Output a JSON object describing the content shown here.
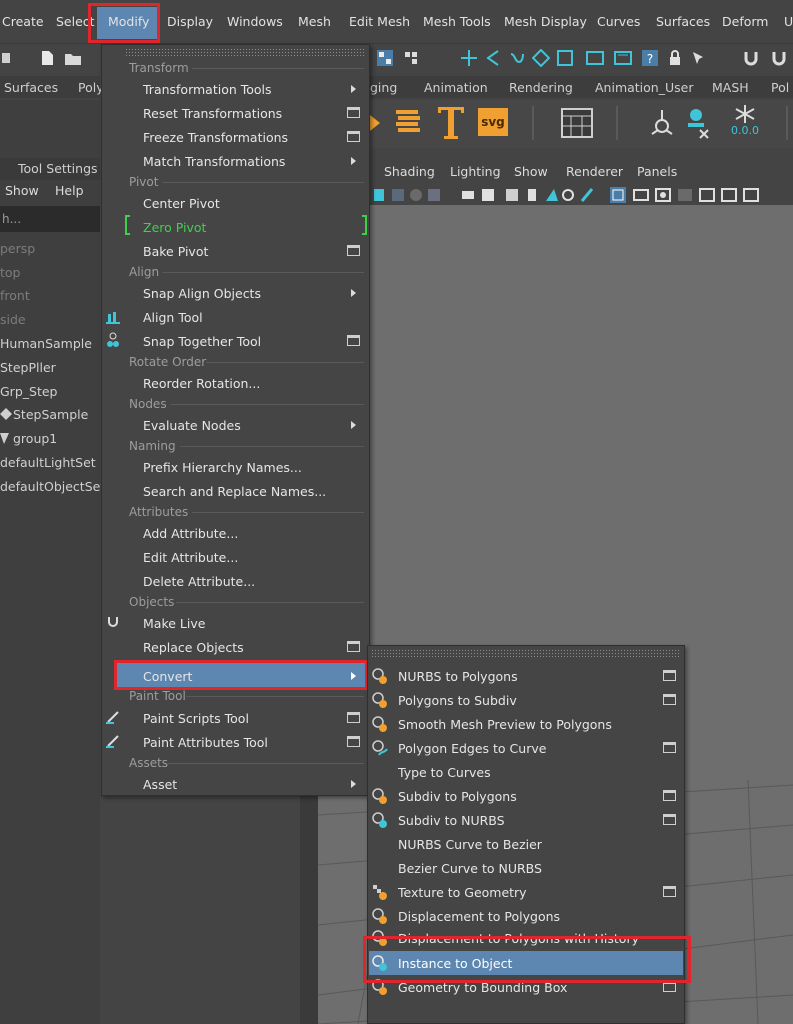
{
  "menubar": {
    "items": [
      "Create",
      "Select",
      "Modify",
      "Display",
      "Windows",
      "Mesh",
      "Edit Mesh",
      "Mesh Tools",
      "Mesh Display",
      "Curves",
      "Surfaces",
      "Deform",
      "U"
    ]
  },
  "shelf": {
    "left_tabs": [
      "Surfaces",
      "Poly"
    ],
    "right_tabs": [
      "ging",
      "Animation",
      "Rendering",
      "Animation_User",
      "MASH",
      "Pol"
    ],
    "svg_label": "svg",
    "counter_value": "0.0.0"
  },
  "left_panel": {
    "tabs": [
      "Tool Settings"
    ],
    "menu": [
      "Show",
      "Help"
    ],
    "search_text": "h...",
    "outliner": [
      "persp",
      "top",
      "front",
      "side",
      "HumanSample",
      "StepPller",
      "Grp_Step",
      "StepSample",
      "group1",
      "defaultLightSet",
      "defaultObjectSet"
    ]
  },
  "viewport": {
    "menu": [
      "Shading",
      "Lighting",
      "Show",
      "Renderer",
      "Panels"
    ]
  },
  "modify_menu": {
    "sections": {
      "transform": "Transform",
      "pivot": "Pivot",
      "align": "Align",
      "rotate_order": "Rotate Order",
      "nodes": "Nodes",
      "naming": "Naming",
      "attributes": "Attributes",
      "objects": "Objects",
      "paint_tool": "Paint Tool",
      "assets": "Assets"
    },
    "items": {
      "transformation_tools": "Transformation Tools",
      "reset_transformations": "Reset Transformations",
      "freeze_transformations": "Freeze Transformations",
      "match_transformations": "Match Transformations",
      "center_pivot": "Center Pivot",
      "zero_pivot": "Zero Pivot",
      "bake_pivot": "Bake Pivot",
      "snap_align_objects": "Snap Align Objects",
      "align_tool": "Align Tool",
      "snap_together_tool": "Snap Together Tool",
      "reorder_rotation": "Reorder Rotation...",
      "evaluate_nodes": "Evaluate Nodes",
      "prefix_hierarchy_names": "Prefix Hierarchy Names...",
      "search_replace_names": "Search and Replace Names...",
      "add_attribute": "Add Attribute...",
      "edit_attribute": "Edit Attribute...",
      "delete_attribute": "Delete Attribute...",
      "make_live": "Make Live",
      "replace_objects": "Replace Objects",
      "convert": "Convert",
      "paint_scripts_tool": "Paint Scripts Tool",
      "paint_attributes_tool": "Paint Attributes Tool",
      "asset": "Asset"
    }
  },
  "convert_submenu": {
    "items": [
      "NURBS to Polygons",
      "Polygons to Subdiv",
      "Smooth Mesh Preview to Polygons",
      "Polygon Edges to Curve",
      "Type to Curves",
      "Subdiv to Polygons",
      "Subdiv to NURBS",
      "NURBS Curve to Bezier",
      "Bezier Curve to NURBS",
      "Texture to Geometry",
      "Displacement to Polygons",
      "Displacement to Polygons with History",
      "Instance to Object",
      "Geometry to Bounding Box"
    ]
  },
  "colors": {
    "highlight": "#5d87b0",
    "annotation_red": "#e0262d",
    "zero_pivot_green": "#3fd04a",
    "icon_orange": "#f0a030",
    "icon_cyan": "#3fc4d8"
  }
}
